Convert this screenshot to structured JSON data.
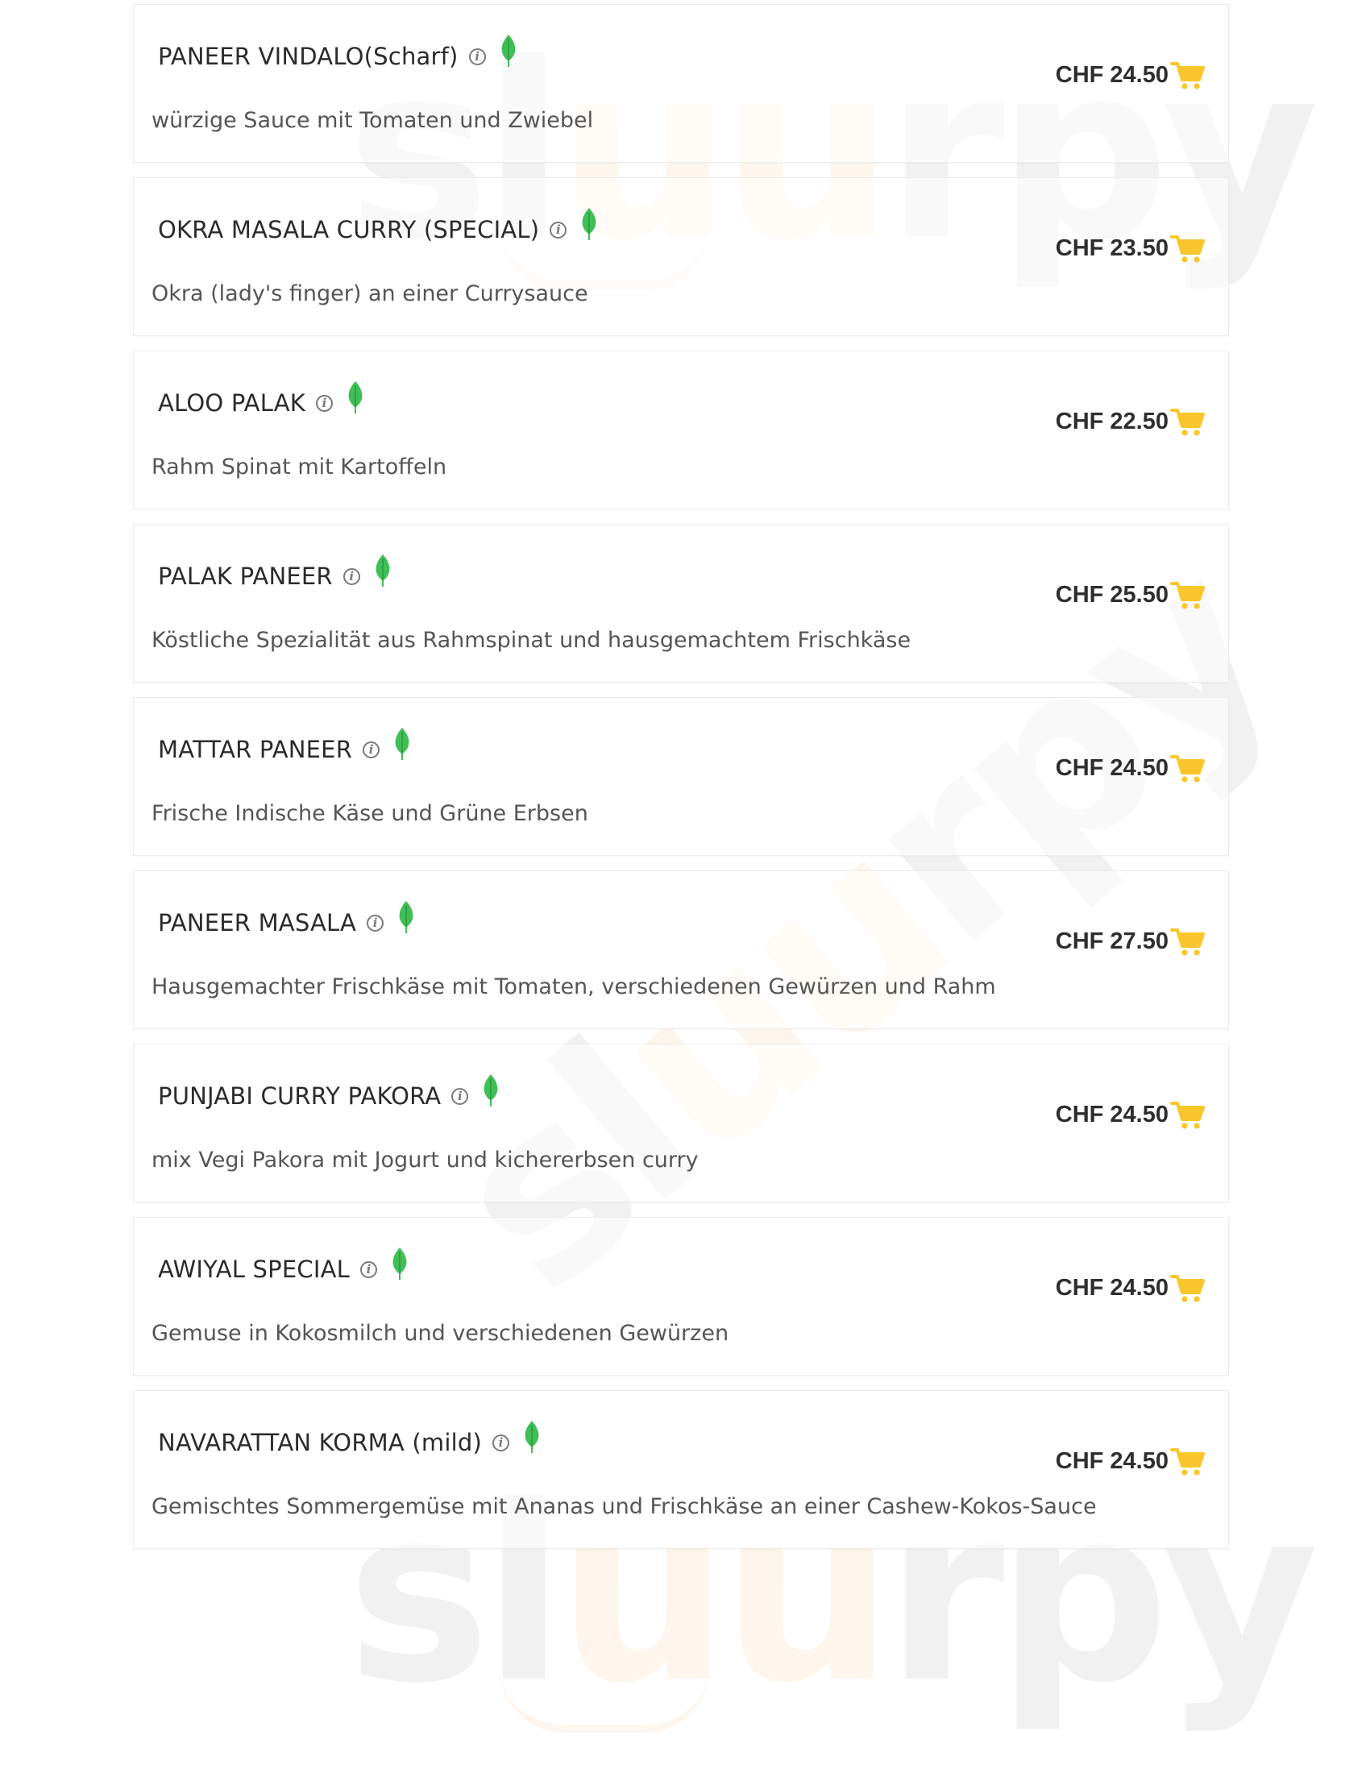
{
  "watermark": {
    "text_left": "sl",
    "text_mid": "uu",
    "text_right": "rpy"
  },
  "currency": "CHF",
  "accent_colors": {
    "cart": "#f9c62b",
    "leaf": "#3fbf56",
    "watermark_orange": "#f88c28"
  },
  "icons": {
    "info": "info-circle-icon",
    "veg": "leaf-icon",
    "cart": "shopping-cart-icon"
  },
  "info_glyph": "i",
  "menu": [
    {
      "name": "PANEER VINDALO(Scharf)",
      "description": "würzige Sauce mit Tomaten und Zwiebel",
      "price": "CHF 24.50"
    },
    {
      "name": "OKRA MASALA CURRY (SPECIAL)",
      "description": "Okra (lady's finger) an einer Currysauce",
      "price": "CHF 23.50"
    },
    {
      "name": "ALOO PALAK",
      "description": "Rahm Spinat mit Kartoffeln",
      "price": "CHF 22.50"
    },
    {
      "name": "PALAK PANEER",
      "description": "Köstliche Spezialität aus Rahmspinat und hausgemachtem Frischkäse",
      "price": "CHF 25.50"
    },
    {
      "name": "MATTAR PANEER",
      "description": "Frische Indische Käse und Grüne Erbsen",
      "price": "CHF 24.50"
    },
    {
      "name": "PANEER MASALA",
      "description": "Hausgemachter Frischkäse mit Tomaten, verschiedenen Gewürzen und Rahm",
      "price": "CHF 27.50"
    },
    {
      "name": "PUNJABI CURRY PAKORA ",
      "description": "mix Vegi Pakora mit Jogurt und kichererbsen curry",
      "price": "CHF 24.50"
    },
    {
      "name": "AWIYAL SPECIAL",
      "description": "Gemuse in Kokosmilch und verschiedenen Gewürzen",
      "price": "CHF 24.50"
    },
    {
      "name": "NAVARATTAN KORMA (mild)",
      "description": "Gemischtes Sommergemüse mit Ananas und Frischkäse an einer Cashew-Kokos-Sauce",
      "price": "CHF 24.50"
    }
  ]
}
